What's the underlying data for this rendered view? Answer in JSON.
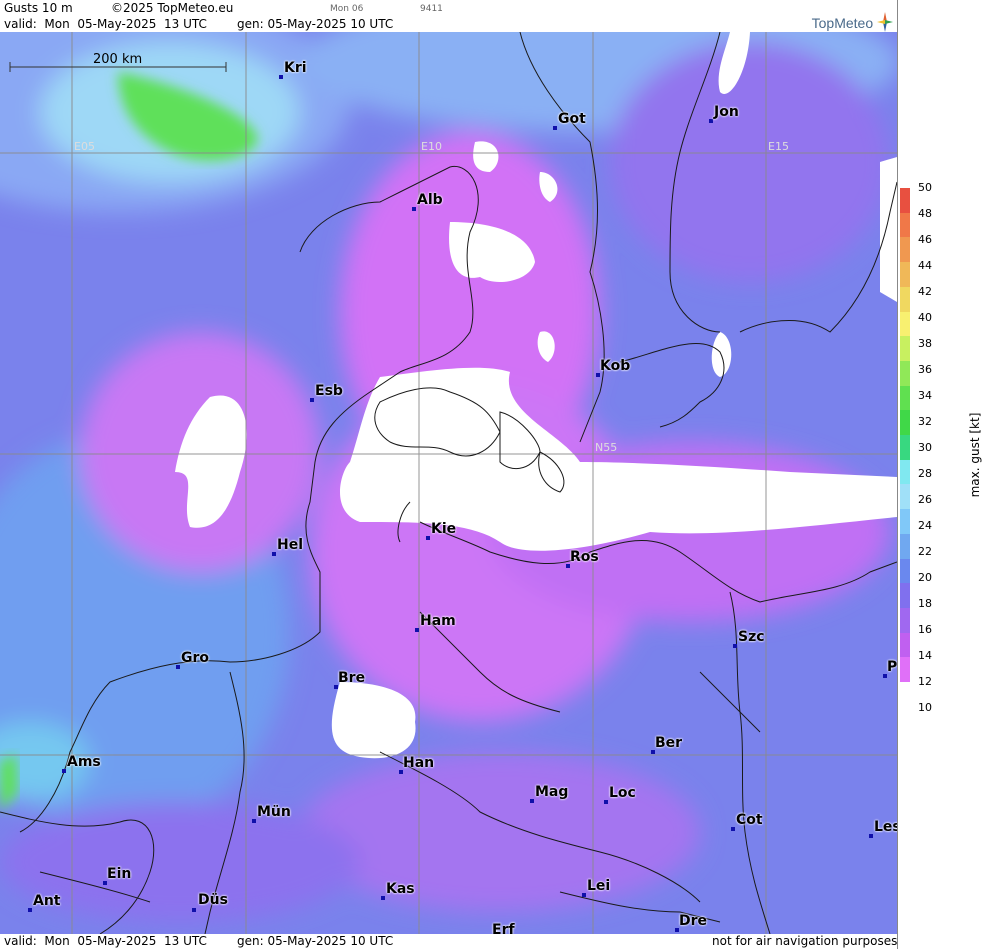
{
  "header": {
    "title": "Gusts 10 m",
    "copyright": "©2025 TopMeteo.eu",
    "day_label": "Mon 06",
    "code": "9411",
    "valid": "valid:  Mon  05-May-2025  13 UTC",
    "gen": "gen: 05-May-2025 10 UTC",
    "logo": "TopMeteo"
  },
  "footer": {
    "valid": "valid:  Mon  05-May-2025  13 UTC",
    "gen": "gen: 05-May-2025 10 UTC",
    "disclaimer": "not for air navigation purposes"
  },
  "map": {
    "scale_label": "200 km",
    "grid_labels": [
      "E05",
      "E10",
      "E15",
      "N55"
    ],
    "cities": [
      "Kri",
      "Got",
      "Jon",
      "Alb",
      "Kob",
      "Esb",
      "Kie",
      "Hel",
      "Ros",
      "Ham",
      "Szc",
      "Gro",
      "Bre",
      "Ber",
      "Ams",
      "Han",
      "Mag",
      "Loc",
      "Mün",
      "Cot",
      "Les",
      "Ein",
      "Kas",
      "Lei",
      "Ant",
      "Düs",
      "Dre",
      "Erf",
      "P"
    ]
  },
  "legend": {
    "axis_label": "max. gust [kt]",
    "ticks": [
      "50",
      "48",
      "46",
      "44",
      "42",
      "40",
      "38",
      "36",
      "34",
      "32",
      "30",
      "28",
      "26",
      "24",
      "22",
      "20",
      "18",
      "16",
      "14",
      "12",
      "10"
    ],
    "colors": [
      "#e85040",
      "#f07848",
      "#f09850",
      "#f0b858",
      "#f0d860",
      "#f8f070",
      "#c8f060",
      "#90e858",
      "#60e050",
      "#40d848",
      "#38d880",
      "#80e8f0",
      "#a0e0f8",
      "#80c8f8",
      "#70a8f0",
      "#6a88ee",
      "#8070ee",
      "#a068f0",
      "#c060f0",
      "#e070f8"
    ]
  }
}
